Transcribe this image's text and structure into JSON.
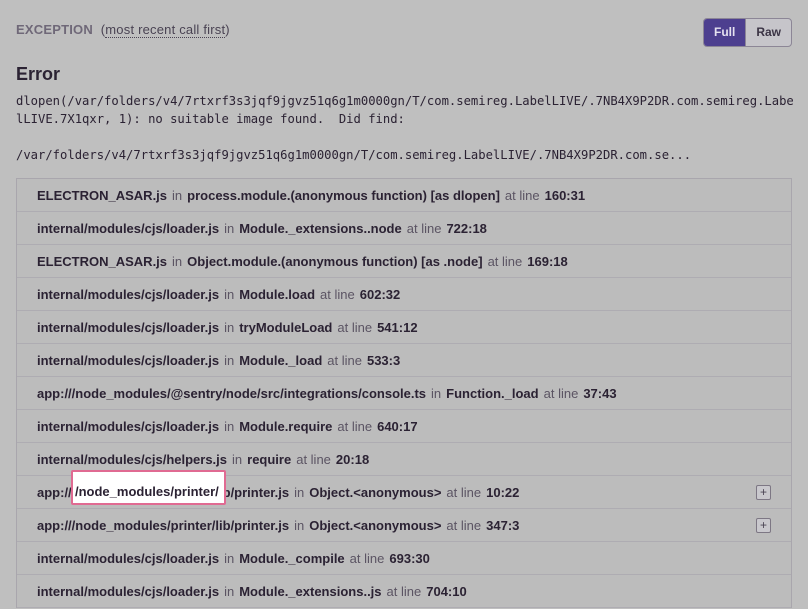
{
  "header": {
    "title": "EXCEPTION",
    "subtitle_prefix": "(",
    "subtitle_link": "most recent call first",
    "subtitle_suffix": ")"
  },
  "toggle": {
    "full_label": "Full",
    "raw_label": "Raw",
    "selected": "Full"
  },
  "error": {
    "type": "Error",
    "message": "dlopen(/var/folders/v4/7rtxrf3s3jqf9jgvz51q6g1m0000gn/T/com.semireg.LabelLIVE/.7NB4X9P2DR.com.semireg.LabelLIVE.7X1qxr, 1): no suitable image found.  Did find:\n\n/var/folders/v4/7rtxrf3s3jqf9jgvz51q6g1m0000gn/T/com.semireg.LabelLIVE/.7NB4X9P2DR.com.se..."
  },
  "labels": {
    "in": "in",
    "at_line": "at line"
  },
  "frames": [
    {
      "file": "ELECTRON_ASAR.js",
      "function": "process.module.(anonymous function) [as dlopen]",
      "line": "160:31",
      "expandable": false
    },
    {
      "file": "internal/modules/cjs/loader.js",
      "function": "Module._extensions..node",
      "line": "722:18",
      "expandable": false
    },
    {
      "file": "ELECTRON_ASAR.js",
      "function": "Object.module.(anonymous function) [as .node]",
      "line": "169:18",
      "expandable": false
    },
    {
      "file": "internal/modules/cjs/loader.js",
      "function": "Module.load",
      "line": "602:32",
      "expandable": false
    },
    {
      "file": "internal/modules/cjs/loader.js",
      "function": "tryModuleLoad",
      "line": "541:12",
      "expandable": false
    },
    {
      "file": "internal/modules/cjs/loader.js",
      "function": "Module._load",
      "line": "533:3",
      "expandable": false
    },
    {
      "file": "app:///node_modules/@sentry/node/src/integrations/console.ts",
      "function": "Function._load",
      "line": "37:43",
      "expandable": false
    },
    {
      "file": "internal/modules/cjs/loader.js",
      "function": "Module.require",
      "line": "640:17",
      "expandable": false
    },
    {
      "file": "internal/modules/cjs/helpers.js",
      "function": "require",
      "line": "20:18",
      "expandable": false
    },
    {
      "file": "app:///node_modules/printer/lib/printer.js",
      "function": "Object.<anonymous>",
      "line": "10:22",
      "expandable": true
    },
    {
      "file": "app:///node_modules/printer/lib/printer.js",
      "function": "Object.<anonymous>",
      "line": "347:3",
      "expandable": true
    },
    {
      "file": "internal/modules/cjs/loader.js",
      "function": "Module._compile",
      "line": "693:30",
      "expandable": false
    },
    {
      "file": "internal/modules/cjs/loader.js",
      "function": "Module._extensions..js",
      "line": "704:10",
      "expandable": false
    }
  ],
  "highlight": {
    "text": "/node_modules/printer/",
    "color": "#e06a92"
  },
  "colors": {
    "background": "#bfbfbf",
    "accent": "#4d3f8f",
    "text": "#2b2233"
  }
}
